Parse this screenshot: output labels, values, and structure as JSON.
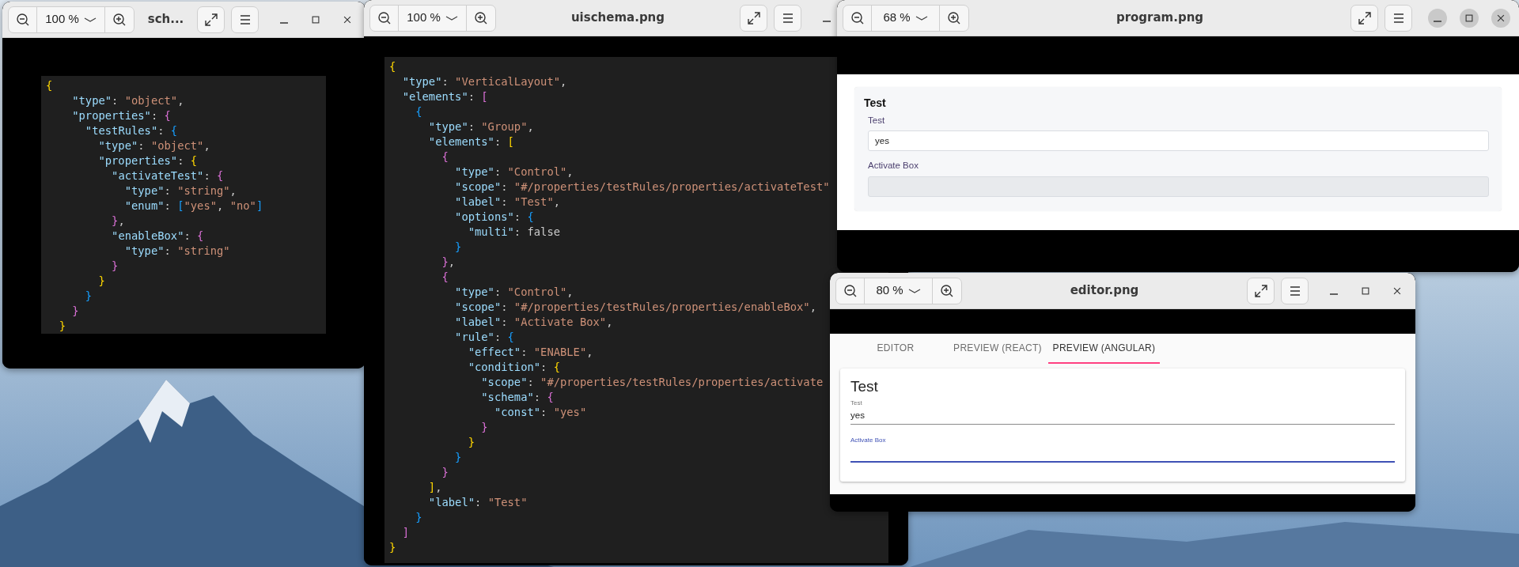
{
  "windows": [
    {
      "title": "sch...",
      "zoom": "100 %",
      "focused": false,
      "content": {
        "kind": "code",
        "lines": [
          "{",
          "    \"type\": \"object\",",
          "    \"properties\": {",
          "      \"testRules\": {",
          "        \"type\": \"object\",",
          "        \"properties\": {",
          "          \"activateTest\": {",
          "            \"type\": \"string\",",
          "            \"enum\": [\"yes\", \"no\"]",
          "          },",
          "          \"enableBox\": {",
          "            \"type\": \"string\"",
          "          }",
          "        }",
          "      }",
          "    }",
          "  }"
        ]
      }
    },
    {
      "title": "uischema.png",
      "zoom": "100 %",
      "focused": false,
      "content": {
        "kind": "code",
        "lines": [
          "{",
          "  \"type\": \"VerticalLayout\",",
          "  \"elements\": [",
          "    {",
          "      \"type\": \"Group\",",
          "      \"elements\": [",
          "        {",
          "          \"type\": \"Control\",",
          "          \"scope\": \"#/properties/testRules/properties/activateTest\"",
          "          \"label\": \"Test\",",
          "          \"options\": {",
          "            \"multi\": false",
          "          }",
          "        },",
          "        {",
          "          \"type\": \"Control\",",
          "          \"scope\": \"#/properties/testRules/properties/enableBox\",",
          "          \"label\": \"Activate Box\",",
          "          \"rule\": {",
          "            \"effect\": \"ENABLE\",",
          "            \"condition\": {",
          "              \"scope\": \"#/properties/testRules/properties/activate",
          "              \"schema\": {",
          "                \"const\": \"yes\"",
          "              }",
          "            }",
          "          }",
          "        }",
          "      ],",
          "      \"label\": \"Test\"",
          "    }",
          "  ]",
          "}"
        ]
      }
    },
    {
      "title": "program.png",
      "zoom": "68 %",
      "focused": true,
      "content": {
        "kind": "form",
        "group": {
          "title": "Test",
          "fields": [
            {
              "label": "Test",
              "value": "yes",
              "disabled": false
            },
            {
              "label": "Activate Box",
              "disabled": true
            }
          ]
        }
      }
    },
    {
      "title": "editor.png",
      "zoom": "80 %",
      "focused": false,
      "content": {
        "kind": "editor",
        "tabs": [
          {
            "label": "EDITOR",
            "selected": false
          },
          {
            "label": "PREVIEW (REACT)",
            "selected": false
          },
          {
            "label": "PREVIEW (ANGULAR)",
            "selected": true
          }
        ],
        "group": {
          "title": "Test",
          "fields": [
            {
              "label": "Test",
              "value": "yes",
              "focused": false
            },
            {
              "label": "Activate Box",
              "focused": true
            }
          ]
        }
      }
    }
  ]
}
